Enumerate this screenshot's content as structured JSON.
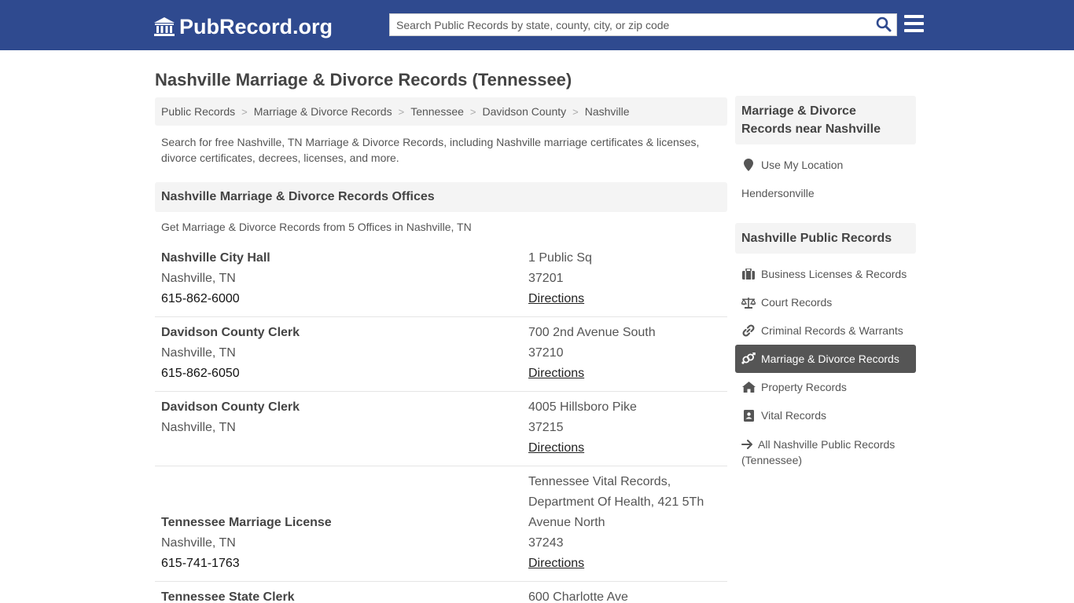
{
  "header": {
    "logo_text": "PubRecord.org",
    "search_placeholder": "Search Public Records by state, county, city, or zip code"
  },
  "page": {
    "title": "Nashville Marriage & Divorce Records (Tennessee)",
    "breadcrumb": [
      "Public Records",
      "Marriage & Divorce Records",
      "Tennessee",
      "Davidson County",
      "Nashville"
    ],
    "breadcrumb_sep": ">",
    "intro": "Search for free Nashville, TN Marriage & Divorce Records, including Nashville marriage certificates & licenses, divorce certificates, decrees, licenses, and more.",
    "offices_heading": "Nashville Marriage & Divorce Records Offices",
    "offices_count": "Get Marriage & Divorce Records from 5 Offices in Nashville, TN"
  },
  "offices": [
    {
      "name": "Nashville City Hall",
      "city": "Nashville, TN",
      "phone": "615-862-6000",
      "address": "1 Public Sq",
      "zip": "37201",
      "directions": "Directions"
    },
    {
      "name": "Davidson County Clerk",
      "city": "Nashville, TN",
      "phone": "615-862-6050",
      "address": "700 2nd Avenue South",
      "zip": "37210",
      "directions": "Directions"
    },
    {
      "name": "Davidson County Clerk",
      "city": "Nashville, TN",
      "phone": "",
      "address": "4005 Hillsboro Pike",
      "zip": "37215",
      "directions": "Directions"
    },
    {
      "name": "Tennessee Marriage License",
      "city": "Nashville, TN",
      "phone": "615-741-1763",
      "address": "Tennessee Vital Records, Department Of Health, 421 5Th Avenue North",
      "zip": "37243",
      "directions": "Directions"
    },
    {
      "name": "Tennessee State Clerk",
      "address": "600 Charlotte Ave"
    }
  ],
  "sidebar": {
    "nearby_heading": "Marriage & Divorce Records near Nashville",
    "use_location": "Use My Location",
    "nearby": [
      "Hendersonville"
    ],
    "public_heading": "Nashville Public Records",
    "items": [
      {
        "label": "Business Licenses & Records",
        "icon": "briefcase-icon"
      },
      {
        "label": "Court Records",
        "icon": "scale-icon"
      },
      {
        "label": "Criminal Records & Warrants",
        "icon": "link-icon"
      },
      {
        "label": "Marriage & Divorce Records",
        "icon": "venus-mars-icon",
        "active": true
      },
      {
        "label": "Property Records",
        "icon": "home-icon"
      },
      {
        "label": "Vital Records",
        "icon": "id-card-icon"
      }
    ],
    "all_records": "All Nashville Public Records (Tennessee)"
  },
  "colors": {
    "header_bg": "#2f4a8f",
    "active_bg": "#555555"
  }
}
